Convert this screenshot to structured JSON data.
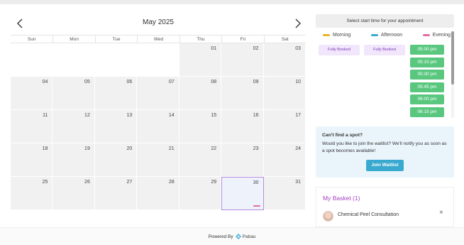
{
  "calendar": {
    "month_label": "May 2025",
    "weekdays": [
      "Sun",
      "Mon",
      "Tue",
      "Wed",
      "Thu",
      "Fri",
      "Sat"
    ],
    "weeks": [
      [
        "",
        "",
        "",
        "",
        "01",
        "02",
        "03"
      ],
      [
        "04",
        "05",
        "06",
        "07",
        "08",
        "09",
        "10"
      ],
      [
        "11",
        "12",
        "13",
        "14",
        "15",
        "16",
        "17"
      ],
      [
        "18",
        "19",
        "20",
        "21",
        "22",
        "23",
        "24"
      ],
      [
        "25",
        "26",
        "27",
        "28",
        "29",
        "30",
        "31"
      ]
    ],
    "selected_day": "30"
  },
  "panel": {
    "title": "Select start time for your appointment",
    "legend": [
      {
        "label": "Morning",
        "color": "#f0b02a"
      },
      {
        "label": "Afternoon",
        "color": "#3aa9cf"
      },
      {
        "label": "Evening",
        "color": "#e06fa8"
      }
    ],
    "morning_status": "Fully Booked",
    "afternoon_status": "Fully Booked",
    "evening_slots": [
      "05:00 pm",
      "05:15 pm",
      "05:30 pm",
      "05:45 pm",
      "06:00 pm",
      "06:15 pm"
    ]
  },
  "waitlist": {
    "question": "Can't find a spot?",
    "message": "Would you like to join the waitlist? We'll notify you as soon as a spot becomes available!",
    "button_label": "Join Waitlist"
  },
  "basket": {
    "title": "My Basket (1)",
    "item": "Chemical Peel Consultation",
    "remove_label": "×"
  },
  "footer": {
    "powered_by": "Powered By",
    "brand": "Pabau"
  }
}
